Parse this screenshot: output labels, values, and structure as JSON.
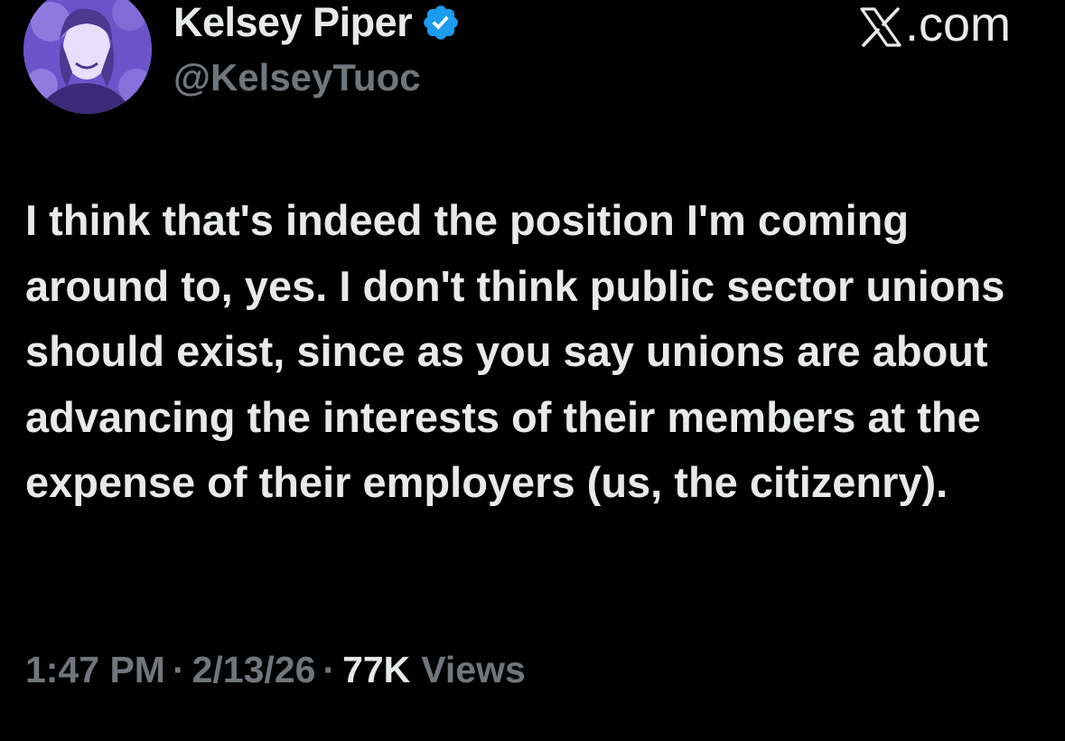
{
  "author": {
    "display_name": "Kelsey Piper",
    "handle": "@KelseyTuoc",
    "verified": true,
    "avatar_icon": "profile-photo-avatar"
  },
  "brand": {
    "label": ".com",
    "logo_icon": "x-logo-icon"
  },
  "tweet": {
    "text": "I think that's indeed the position I'm coming around to, yes. I don't think public sector unions should exist, since as you say unions are about advancing the interests of their members at the expense of their employers (us, the citizenry)."
  },
  "meta": {
    "time": "1:47 PM",
    "separator": "·",
    "date": "2/13/26",
    "views_count": "77K",
    "views_label": "Views"
  },
  "colors": {
    "background": "#000000",
    "primary_text": "#e7e9ea",
    "secondary_text": "#71767b",
    "verified_blue": "#1d9bf0",
    "avatar_purple": "#6b54c9"
  }
}
